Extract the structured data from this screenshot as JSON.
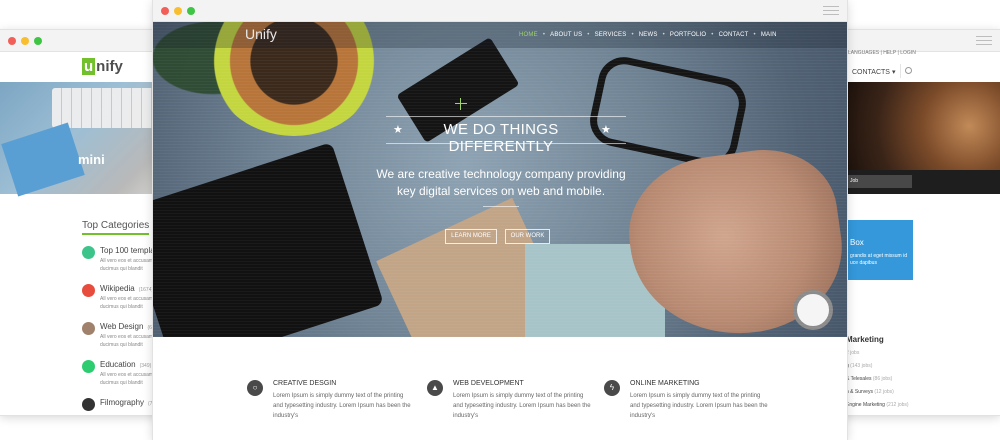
{
  "left_window": {
    "logo_rest": "nify",
    "logo_mark": "u",
    "hero_word": "mini",
    "categories_title": "Top Categories",
    "categories": [
      {
        "name": "Top 100 templat",
        "count": "",
        "desc": "All vero eos et accusam\nducimus qui blandit",
        "icon": "tag-icon",
        "color": "#3cc48b"
      },
      {
        "name": "Wikipedia",
        "count": "(1674)",
        "desc": "All vero eos et accusam\nducimus qui blandit",
        "icon": "book-icon",
        "color": "#e74c3c"
      },
      {
        "name": "Web Design",
        "count": "(671)",
        "desc": "All vero eos et accusam\nducimus qui blandit",
        "icon": "pencil-icon",
        "color": "#a0826c"
      },
      {
        "name": "Education",
        "count": "(349)",
        "desc": "All vero eos et accusam\nducimus qui blandit",
        "icon": "graduation-icon",
        "color": "#2ecc71"
      },
      {
        "name": "Filmography",
        "count": "(750)",
        "desc": "",
        "icon": "film-icon",
        "color": "#333333"
      }
    ]
  },
  "right_window": {
    "top_links": "LANGUAGES  |  HELP  |  LOGIN",
    "nav_item": "CONTACTS",
    "nav_caret": "▾",
    "job_button": "Job",
    "blue_box_title": "Box",
    "blue_box_desc": "grandis at eget missum id\nuce dapibus",
    "marketing_title": "Marketing",
    "marketing_items": [
      {
        "label": "",
        "count": "2 jobs"
      },
      {
        "label": "g",
        "count": "(143 jobs)"
      },
      {
        "label": "& Telesales",
        "count": "(86 jobs)"
      },
      {
        "label": "h & Surveys",
        "count": "(12 jobs)"
      },
      {
        "label": "Engine Marketing",
        "count": "(212 jobs)"
      }
    ]
  },
  "center_window": {
    "logo": "Unify",
    "nav": [
      {
        "label": "HOME",
        "active": true
      },
      {
        "label": "ABOUT US",
        "active": false
      },
      {
        "label": "SERVICES",
        "active": false
      },
      {
        "label": "NEWS",
        "active": false
      },
      {
        "label": "PORTFOLIO",
        "active": false
      },
      {
        "label": "CONTACT",
        "active": false
      },
      {
        "label": "MAIN",
        "active": false
      }
    ],
    "hero_title": "WE DO THINGS DIFFERENTLY",
    "hero_subtitle": "We are creative technology company providing key digital services on web and mobile.",
    "btn_learn_more": "LEARN MORE",
    "btn_our_work": "OUR WORK",
    "features": [
      {
        "title": "CREATIVE DESGIN",
        "desc": "Lorem Ipsum is simply dummy text of the printing and typesetting industry. Lorem Ipsum has been the industry's",
        "icon": "lightbulb-icon",
        "glyph": "○"
      },
      {
        "title": "WEB DEVELOPMENT",
        "desc": "Lorem Ipsum is simply dummy text of the printing and typesetting industry. Lorem Ipsum has been the industry's",
        "icon": "pen-nib-icon",
        "glyph": "▲"
      },
      {
        "title": "ONLINE MARKETING",
        "desc": "Lorem Ipsum is simply dummy text of the printing and typesetting industry. Lorem Ipsum has been the industry's",
        "icon": "lightning-icon",
        "glyph": "ϟ"
      }
    ]
  },
  "colors": {
    "brand_green": "#72c02c",
    "nav_active": "#9ed36a",
    "blue_box": "#3498db"
  }
}
